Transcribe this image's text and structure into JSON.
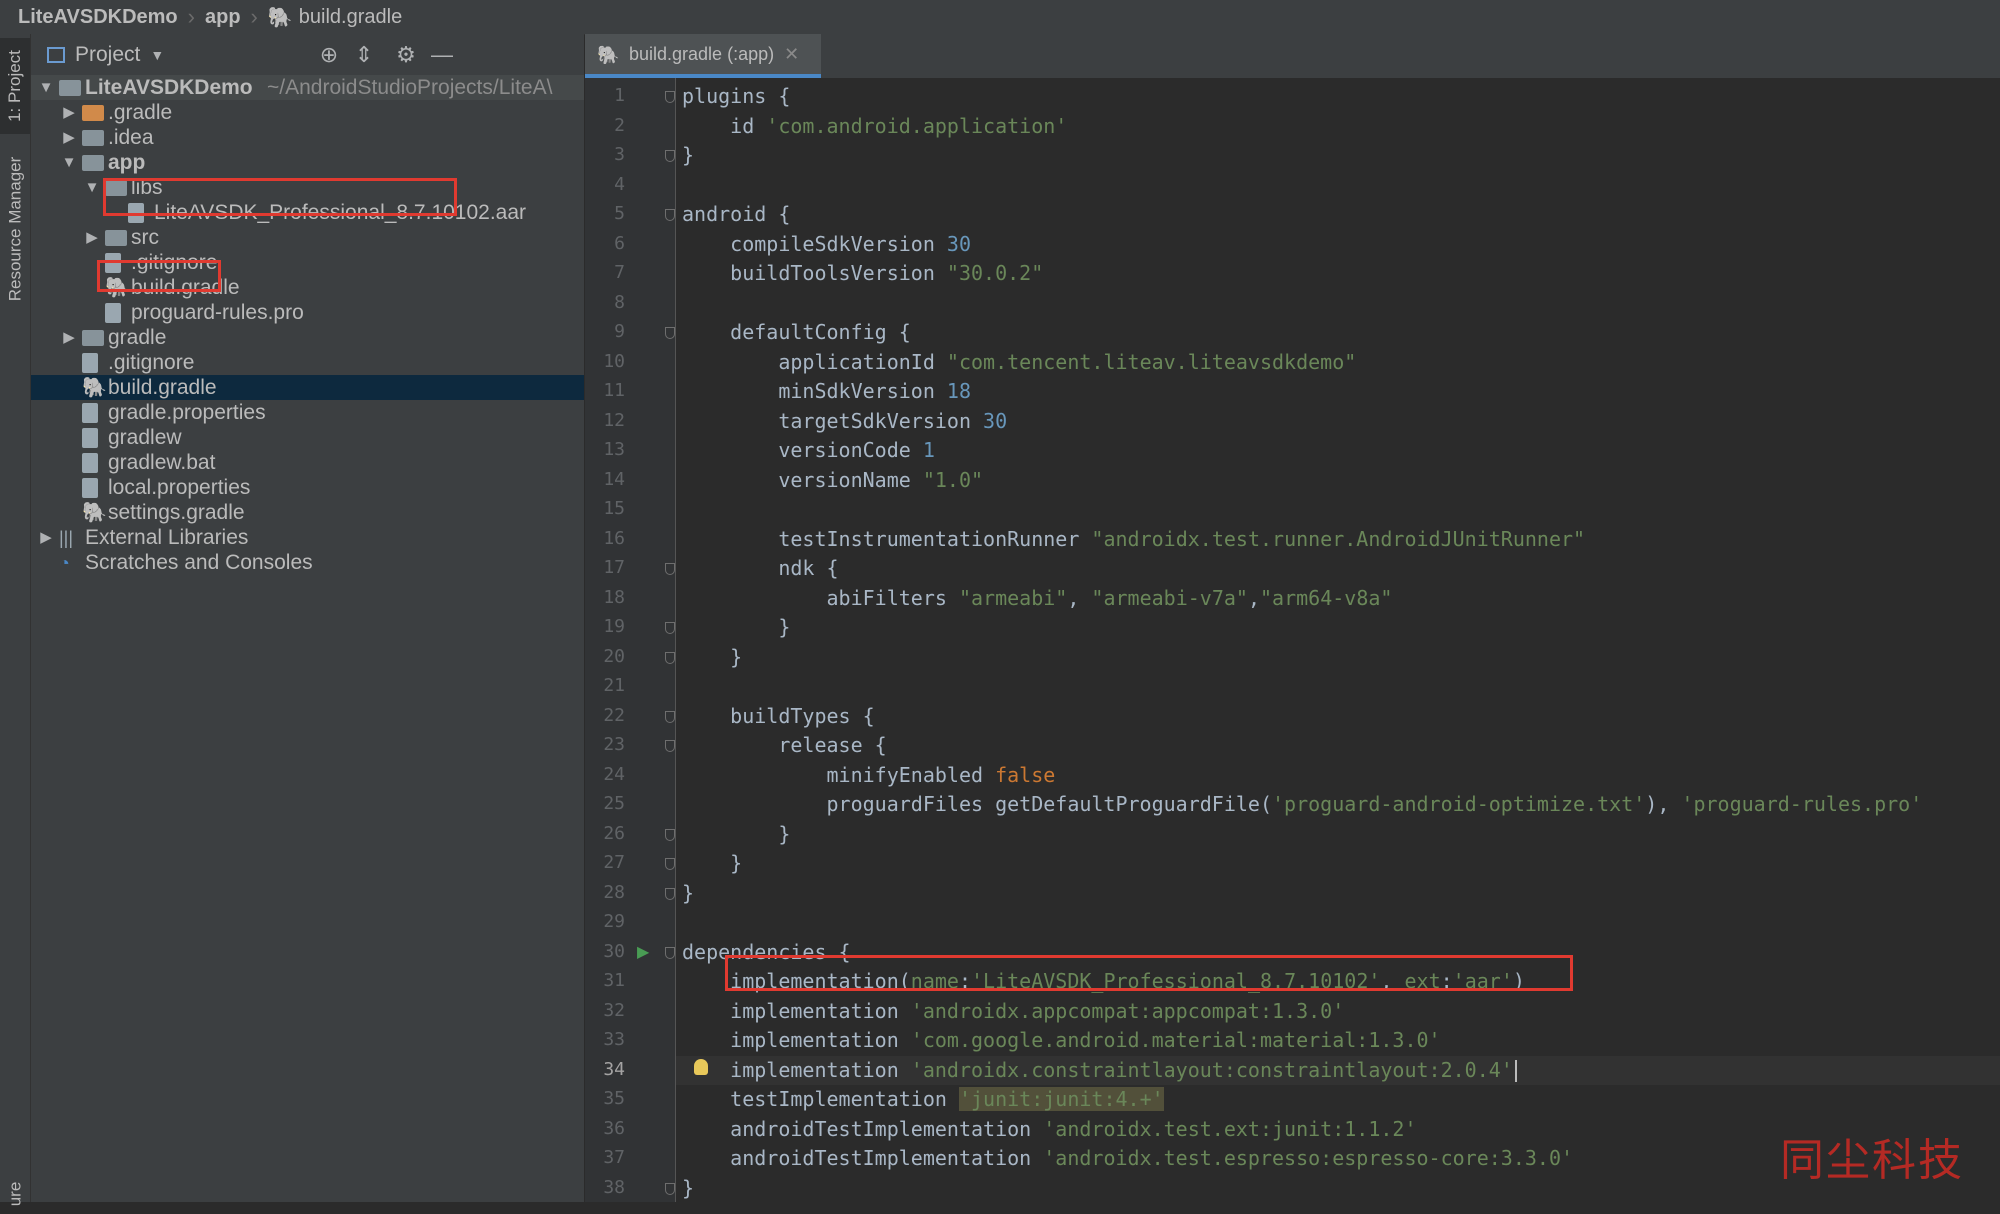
{
  "breadcrumb": {
    "project": "LiteAVSDKDemo",
    "module": "app",
    "file": "build.gradle"
  },
  "tool_strip": {
    "project_tab": "1: Project",
    "resource_tab": "Resource Manager",
    "bottom_tab": "ure"
  },
  "project_panel": {
    "title": "Project",
    "tree": [
      {
        "label": "LiteAVSDKDemo",
        "suffix": "~/AndroidStudioProjects/LiteA\\",
        "depth": 0,
        "arrow": "down",
        "icon": "module-folder-icon",
        "bold": true
      },
      {
        "label": ".gradle",
        "depth": 1,
        "arrow": "right",
        "icon": "orange-folder-icon"
      },
      {
        "label": ".idea",
        "depth": 1,
        "arrow": "right",
        "icon": "folder-icon"
      },
      {
        "label": "app",
        "depth": 1,
        "arrow": "down",
        "icon": "module-folder-icon",
        "bold": true
      },
      {
        "label": "libs",
        "depth": 2,
        "arrow": "down",
        "icon": "folder-icon"
      },
      {
        "label": "LiteAVSDK_Professional_8.7.10102.aar",
        "depth": 3,
        "arrow": "",
        "icon": "aar-file-icon",
        "highlighted": true
      },
      {
        "label": "src",
        "depth": 2,
        "arrow": "right",
        "icon": "folder-icon"
      },
      {
        "label": ".gitignore",
        "depth": 2,
        "arrow": "",
        "icon": "ignore-file-icon"
      },
      {
        "label": "build.gradle",
        "depth": 2,
        "arrow": "",
        "icon": "gradle-icon",
        "highlighted": true
      },
      {
        "label": "proguard-rules.pro",
        "depth": 2,
        "arrow": "",
        "icon": "text-file-icon"
      },
      {
        "label": "gradle",
        "depth": 1,
        "arrow": "right",
        "icon": "folder-icon"
      },
      {
        "label": ".gitignore",
        "depth": 1,
        "arrow": "",
        "icon": "ignore-file-icon"
      },
      {
        "label": "build.gradle",
        "depth": 1,
        "arrow": "",
        "icon": "gradle-icon",
        "selected": true
      },
      {
        "label": "gradle.properties",
        "depth": 1,
        "arrow": "",
        "icon": "properties-file-icon"
      },
      {
        "label": "gradlew",
        "depth": 1,
        "arrow": "",
        "icon": "terminal-file-icon"
      },
      {
        "label": "gradlew.bat",
        "depth": 1,
        "arrow": "",
        "icon": "text-file-icon"
      },
      {
        "label": "local.properties",
        "depth": 1,
        "arrow": "",
        "icon": "properties-file-icon"
      },
      {
        "label": "settings.gradle",
        "depth": 1,
        "arrow": "",
        "icon": "gradle-icon"
      },
      {
        "label": "External Libraries",
        "depth": 0,
        "arrow": "right",
        "icon": "libraries-icon"
      },
      {
        "label": "Scratches and Consoles",
        "depth": 0,
        "arrow": "",
        "icon": "scratches-icon"
      }
    ]
  },
  "editor": {
    "tab_label": "build.gradle (:app)",
    "current_line": 34,
    "lines": [
      {
        "n": "1",
        "fold": true,
        "t": [
          [
            "plugins {",
            ""
          ]
        ]
      },
      {
        "n": "2",
        "t": [
          [
            "    id ",
            ""
          ],
          [
            "'com.android.application'",
            "s"
          ]
        ]
      },
      {
        "n": "3",
        "fold": true,
        "t": [
          [
            "}",
            ""
          ]
        ]
      },
      {
        "n": "4",
        "t": []
      },
      {
        "n": "5",
        "fold": true,
        "t": [
          [
            "android {",
            ""
          ]
        ]
      },
      {
        "n": "6",
        "t": [
          [
            "    compileSdkVersion ",
            ""
          ],
          [
            "30",
            "n"
          ]
        ]
      },
      {
        "n": "7",
        "t": [
          [
            "    buildToolsVersion ",
            ""
          ],
          [
            "\"30.0.2\"",
            "s"
          ]
        ]
      },
      {
        "n": "8",
        "t": []
      },
      {
        "n": "9",
        "fold": true,
        "t": [
          [
            "    defaultConfig {",
            ""
          ]
        ]
      },
      {
        "n": "10",
        "t": [
          [
            "        applicationId ",
            ""
          ],
          [
            "\"com.tencent.liteav.liteavsdkdemo\"",
            "s"
          ]
        ]
      },
      {
        "n": "11",
        "t": [
          [
            "        minSdkVersion ",
            ""
          ],
          [
            "18",
            "n"
          ]
        ]
      },
      {
        "n": "12",
        "t": [
          [
            "        targetSdkVersion ",
            ""
          ],
          [
            "30",
            "n"
          ]
        ]
      },
      {
        "n": "13",
        "t": [
          [
            "        versionCode ",
            ""
          ],
          [
            "1",
            "n"
          ]
        ]
      },
      {
        "n": "14",
        "t": [
          [
            "        versionName ",
            ""
          ],
          [
            "\"1.0\"",
            "s"
          ]
        ]
      },
      {
        "n": "15",
        "t": []
      },
      {
        "n": "16",
        "t": [
          [
            "        testInstrumentationRunner ",
            ""
          ],
          [
            "\"androidx.test.runner.AndroidJUnitRunner\"",
            "s"
          ]
        ]
      },
      {
        "n": "17",
        "fold": true,
        "t": [
          [
            "        ndk {",
            ""
          ]
        ]
      },
      {
        "n": "18",
        "t": [
          [
            "            abiFilters ",
            ""
          ],
          [
            "\"armeabi\"",
            "s"
          ],
          [
            ", ",
            ""
          ],
          [
            "\"armeabi-v7a\"",
            "s"
          ],
          [
            ",",
            ""
          ],
          [
            "\"arm64-v8a\"",
            "s"
          ]
        ]
      },
      {
        "n": "19",
        "fold": true,
        "t": [
          [
            "        }",
            ""
          ]
        ]
      },
      {
        "n": "20",
        "fold": true,
        "t": [
          [
            "    }",
            ""
          ]
        ]
      },
      {
        "n": "21",
        "t": []
      },
      {
        "n": "22",
        "fold": true,
        "t": [
          [
            "    buildTypes {",
            ""
          ]
        ]
      },
      {
        "n": "23",
        "fold": true,
        "t": [
          [
            "        release {",
            ""
          ]
        ]
      },
      {
        "n": "24",
        "t": [
          [
            "            minifyEnabled ",
            ""
          ],
          [
            "false",
            "k"
          ]
        ]
      },
      {
        "n": "25",
        "t": [
          [
            "            proguardFiles getDefaultProguardFile(",
            ""
          ],
          [
            "'proguard-android-optimize.txt'",
            "s"
          ],
          [
            "), ",
            ""
          ],
          [
            "'proguard-rules.pro'",
            "s"
          ]
        ]
      },
      {
        "n": "26",
        "fold": true,
        "t": [
          [
            "        }",
            ""
          ]
        ]
      },
      {
        "n": "27",
        "fold": true,
        "t": [
          [
            "    }",
            ""
          ]
        ]
      },
      {
        "n": "28",
        "fold": true,
        "t": [
          [
            "}",
            ""
          ]
        ]
      },
      {
        "n": "29",
        "t": []
      },
      {
        "n": "30",
        "fold": true,
        "run": true,
        "t": [
          [
            "dependencies {",
            ""
          ]
        ]
      },
      {
        "n": "31",
        "t": [
          [
            "    implementation(",
            ""
          ],
          [
            "name",
            "s"
          ],
          [
            ":",
            ""
          ],
          [
            "'LiteAVSDK_Professional_8.7.10102'",
            "s"
          ],
          [
            ", ",
            ""
          ],
          [
            "ext",
            "s"
          ],
          [
            ":",
            ""
          ],
          [
            "'aar'",
            "s"
          ],
          [
            ")",
            ""
          ]
        ]
      },
      {
        "n": "32",
        "t": [
          [
            "    implementation ",
            ""
          ],
          [
            "'androidx.appcompat:appcompat:1.3.0'",
            "s"
          ]
        ]
      },
      {
        "n": "33",
        "t": [
          [
            "    implementation ",
            ""
          ],
          [
            "'com.google.android.material:material:1.3.0'",
            "s"
          ]
        ]
      },
      {
        "n": "34",
        "bulb": true,
        "t": [
          [
            "    implementation ",
            ""
          ],
          [
            "'androidx.constraintlayout:constraintlayout:2.0.4'",
            "s"
          ]
        ]
      },
      {
        "n": "35",
        "t": [
          [
            "    testImplementation ",
            ""
          ],
          [
            "'junit:junit:4.+'",
            "s warn"
          ]
        ]
      },
      {
        "n": "36",
        "t": [
          [
            "    androidTestImplementation ",
            ""
          ],
          [
            "'androidx.test.ext:junit:1.1.2'",
            "s"
          ]
        ]
      },
      {
        "n": "37",
        "t": [
          [
            "    androidTestImplementation ",
            ""
          ],
          [
            "'androidx.test.espresso:espresso-core:3.3.0'",
            "s"
          ]
        ]
      },
      {
        "n": "38",
        "fold": true,
        "t": [
          [
            "}",
            ""
          ]
        ]
      }
    ]
  },
  "watermark": "同尘科技",
  "colors": {
    "highlight_box": "#e03a30",
    "selection": "#0d293e",
    "string": "#6a8759",
    "number": "#6897bb",
    "keyword": "#cc7832"
  }
}
